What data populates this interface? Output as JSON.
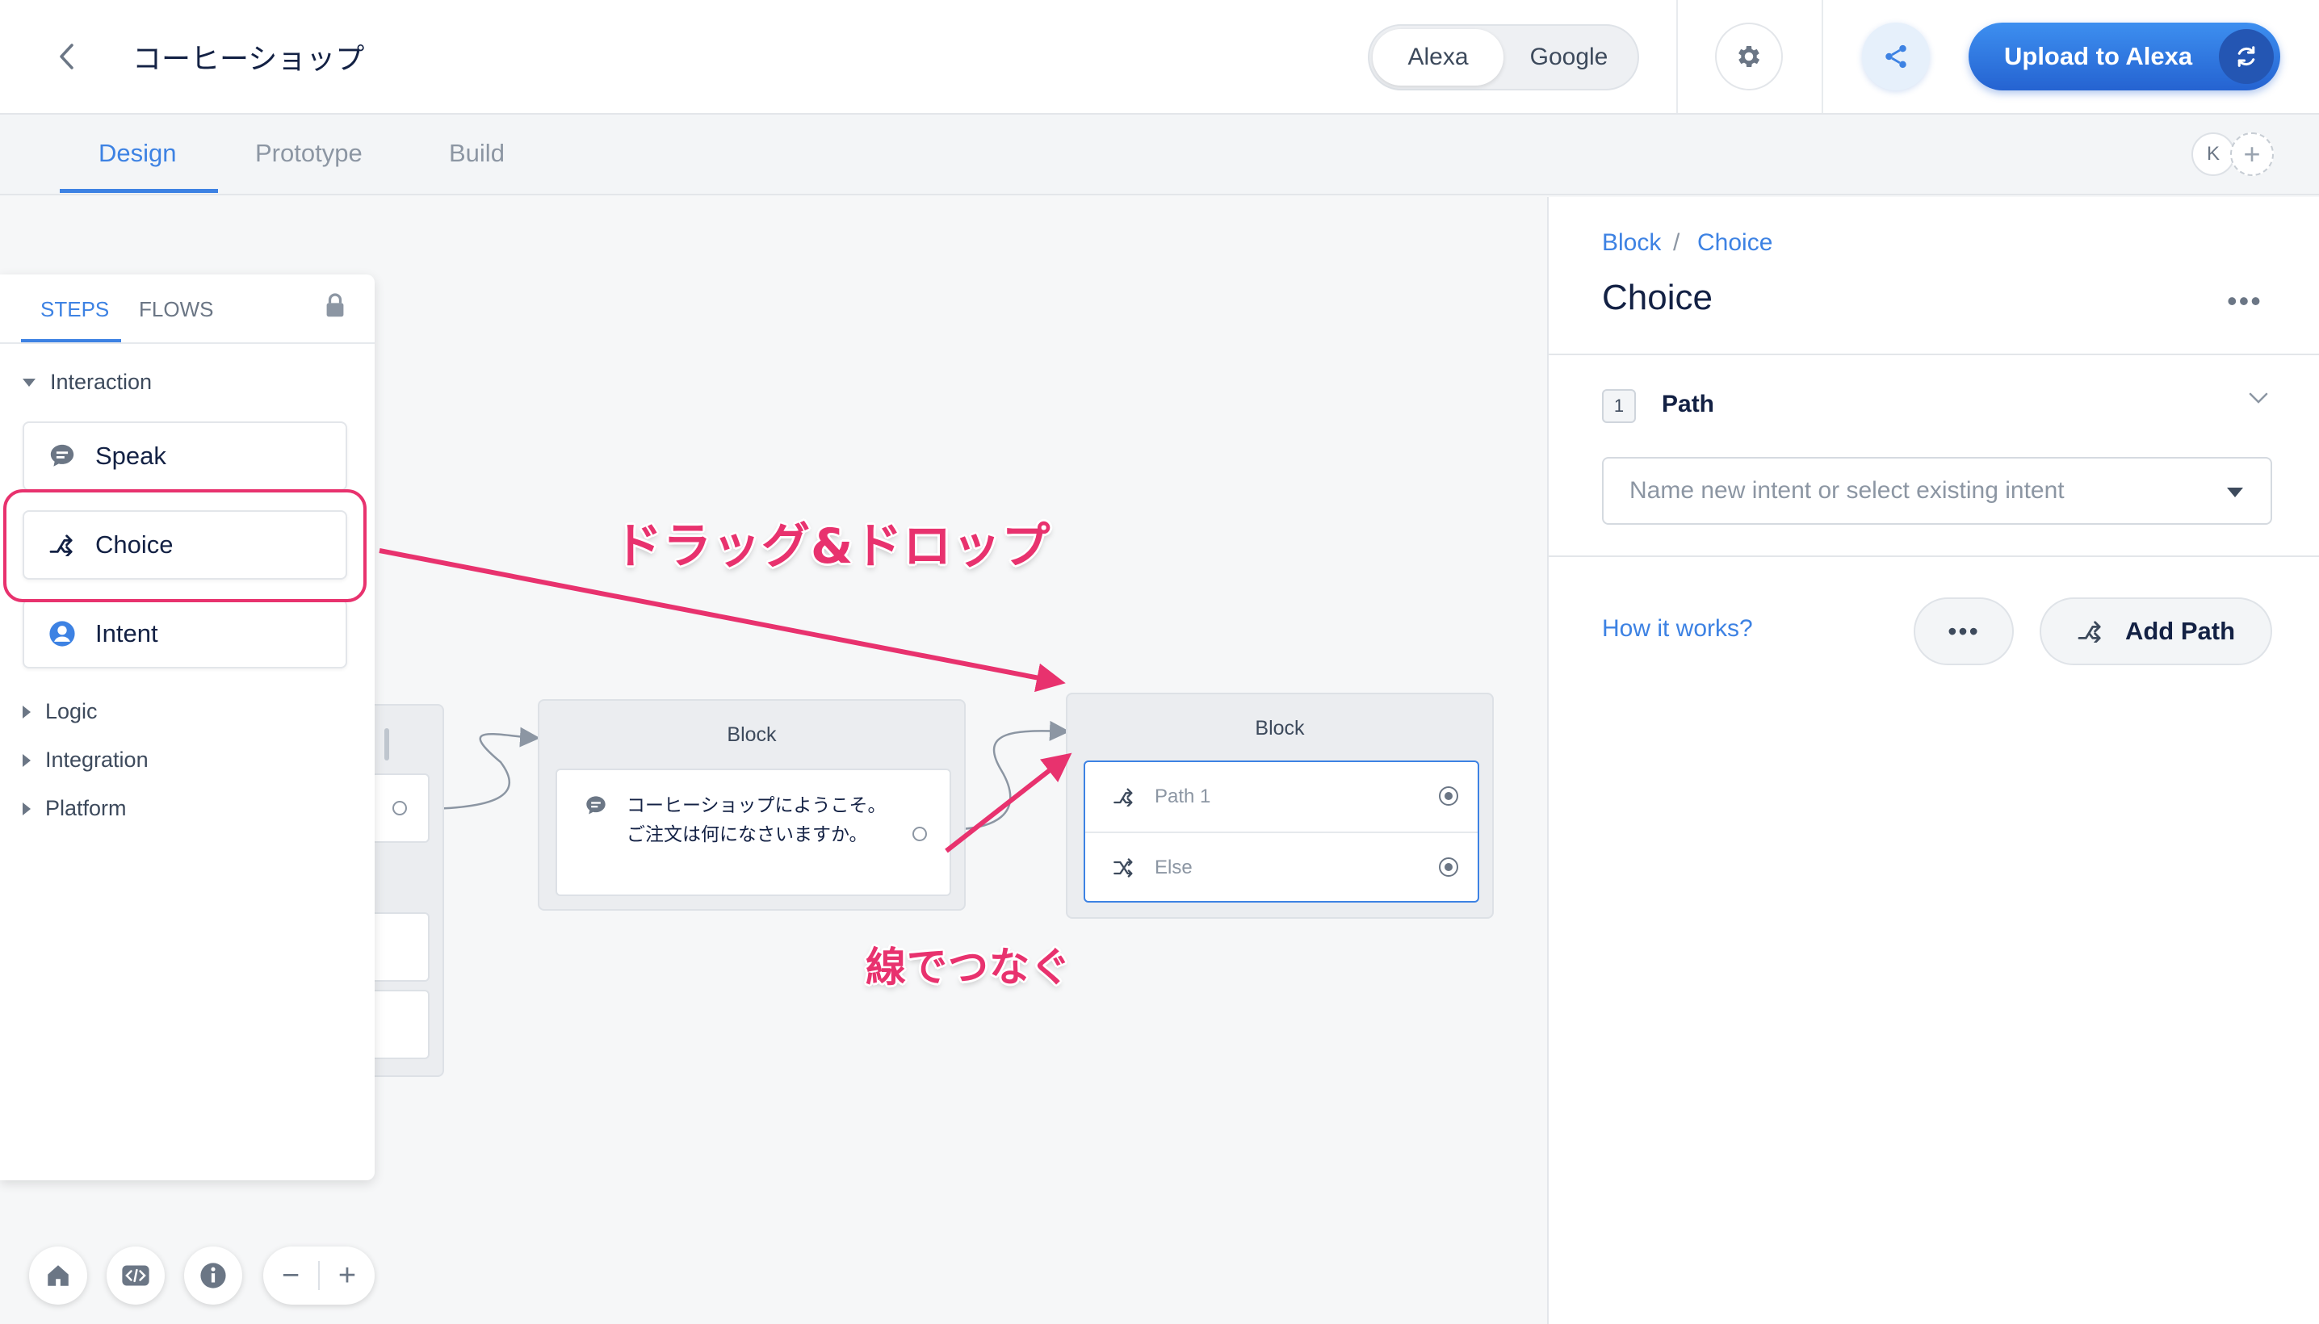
{
  "header": {
    "project_title": "コーヒーショップ",
    "platforms": [
      "Alexa",
      "Google"
    ],
    "active_platform": "Alexa",
    "upload_label": "Upload to Alexa"
  },
  "tabs": [
    {
      "label": "Design",
      "active": true
    },
    {
      "label": "Prototype",
      "active": false
    },
    {
      "label": "Build",
      "active": false
    }
  ],
  "collaborator_initial": "K",
  "steps_panel": {
    "tabs": [
      "STEPS",
      "FLOWS"
    ],
    "active_tab": "STEPS",
    "sections": [
      {
        "label": "Interaction",
        "expanded": true,
        "items": [
          "Speak",
          "Choice",
          "Intent"
        ]
      },
      {
        "label": "Logic",
        "expanded": false
      },
      {
        "label": "Integration",
        "expanded": false
      },
      {
        "label": "Platform",
        "expanded": false
      }
    ]
  },
  "canvas": {
    "block1": {
      "title": "Block",
      "speak_text": "コーヒーショップにようこそ。ご注文は何になさいますか。"
    },
    "block2": {
      "title": "Block",
      "paths": [
        "Path 1",
        "Else"
      ]
    },
    "annotations": {
      "drag_drop": "ドラッグ&ドロップ",
      "connect": "線でつなぐ"
    }
  },
  "editor": {
    "breadcrumb": [
      "Block",
      "Choice"
    ],
    "title": "Choice",
    "path_number": "1",
    "path_title": "Path",
    "intent_placeholder": "Name new intent or select existing intent",
    "how_it_works": "How it works?",
    "add_path_label": "Add Path"
  },
  "colors": {
    "accent": "#3d82e3",
    "annotation": "#e8326e",
    "upload_button": "#2563d1"
  }
}
